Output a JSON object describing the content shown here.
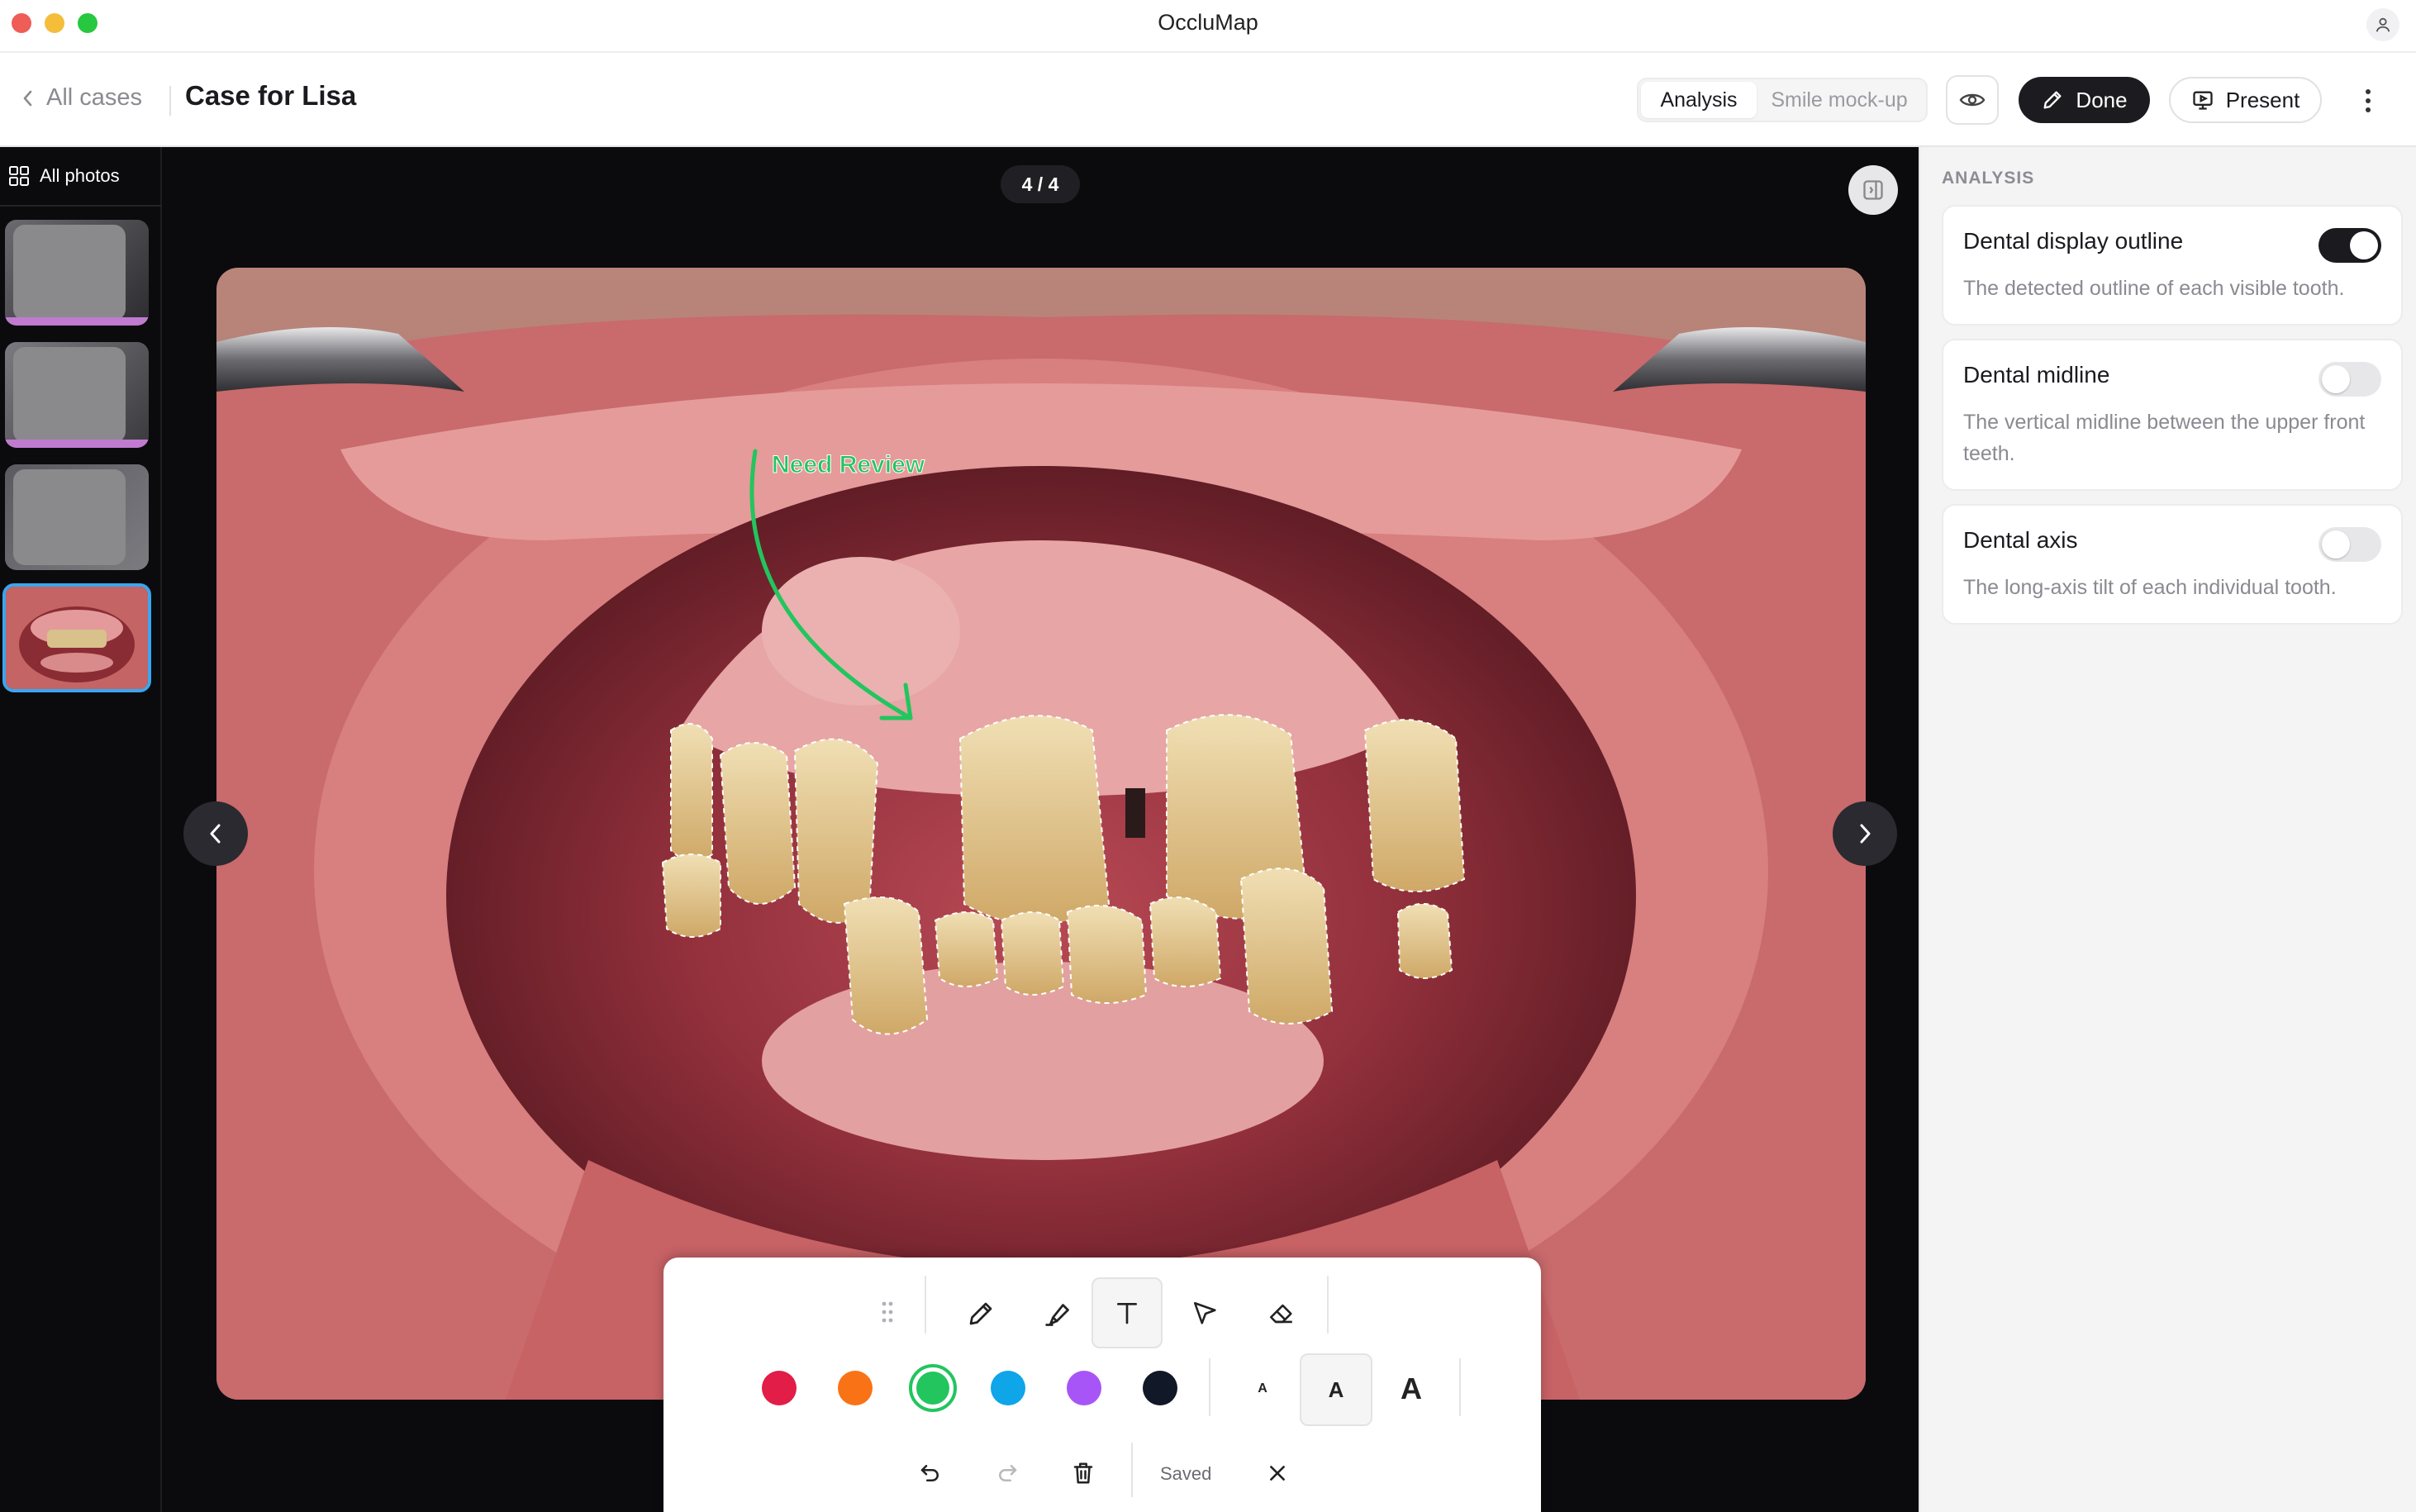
{
  "window": {
    "title": "OccluMap"
  },
  "header": {
    "back_label": "All cases",
    "case_title": "Case for Lisa",
    "tabs": [
      {
        "label": "Analysis",
        "active": true
      },
      {
        "label": "Smile mock-up",
        "active": false
      }
    ],
    "done_label": "Done",
    "present_label": "Present"
  },
  "sidebar": {
    "all_photos_label": "All photos",
    "thumbnails": [
      {
        "kind": "placeholder"
      },
      {
        "kind": "placeholder"
      },
      {
        "kind": "placeholder"
      },
      {
        "kind": "intraoral-photo",
        "selected": true
      }
    ]
  },
  "viewer": {
    "counter": "4 / 4",
    "annotation": {
      "text": "Need Review",
      "color": "#22c55e"
    }
  },
  "toolbar": {
    "tools": [
      "pencil",
      "highlighter",
      "text",
      "select",
      "eraser"
    ],
    "active_tool": "text",
    "colors": [
      "#e11d48",
      "#f97316",
      "#22c55e",
      "#0ea5e9",
      "#a855f7",
      "#111827"
    ],
    "selected_color": "#22c55e",
    "text_sizes": [
      "A",
      "A",
      "A"
    ],
    "selected_text_size": 1,
    "status": "Saved"
  },
  "analysis": {
    "heading": "ANALYSIS",
    "options": [
      {
        "title": "Dental display outline",
        "description": "The detected outline of each visible tooth.",
        "enabled": true
      },
      {
        "title": "Dental midline",
        "description": "The vertical midline between the upper front teeth.",
        "enabled": false
      },
      {
        "title": "Dental axis",
        "description": "The long-axis tilt of each individual tooth.",
        "enabled": false
      }
    ]
  }
}
